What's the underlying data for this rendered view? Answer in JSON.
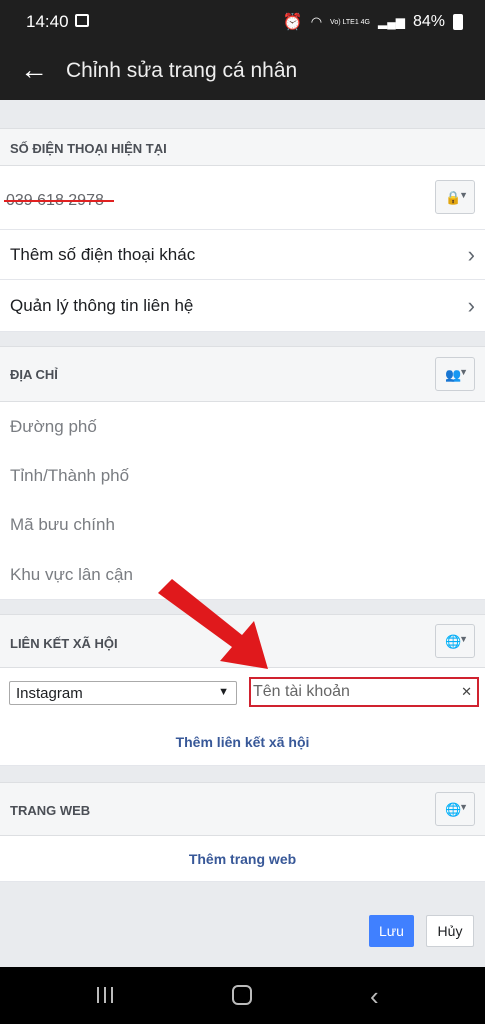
{
  "status_bar": {
    "time": "14:40",
    "network": "Vo) LTE1 4G",
    "battery": "84%"
  },
  "app_bar": {
    "back": "←",
    "title": "Chỉnh sửa trang cá nhân"
  },
  "phone_section": {
    "header": "SỐ ĐIỆN THOẠI HIỆN TẠI",
    "phone_number": "039 618 2978",
    "add_phone": "Thêm số điện thoại khác",
    "manage_contact": "Quản lý thông tin liên hệ"
  },
  "address_section": {
    "header": "ĐỊA CHỈ",
    "street_placeholder": "Đường phố",
    "city_placeholder": "Tỉnh/Thành phố",
    "zip_placeholder": "Mã bưu chính",
    "neighborhood_placeholder": "Khu vực lân cận"
  },
  "social_section": {
    "header": "LIÊN KẾT XÃ HỘI",
    "network_selected": "Instagram",
    "account_placeholder": "Tên tài khoản",
    "add_link": "Thêm liên kết xã hội"
  },
  "website_section": {
    "header": "TRANG WEB",
    "add_link": "Thêm trang web"
  },
  "actions": {
    "save": "Lưu",
    "cancel": "Hủy"
  },
  "icons": {
    "back": "arrow-left-icon",
    "lock": "lock-icon",
    "friends": "friends-icon",
    "globe": "globe-icon",
    "chevron": "chevron-right-icon",
    "clear": "clear-icon"
  },
  "colors": {
    "accent": "#4080ff",
    "link": "#385898",
    "highlight": "#d0222f",
    "arrow": "#e0191c"
  }
}
